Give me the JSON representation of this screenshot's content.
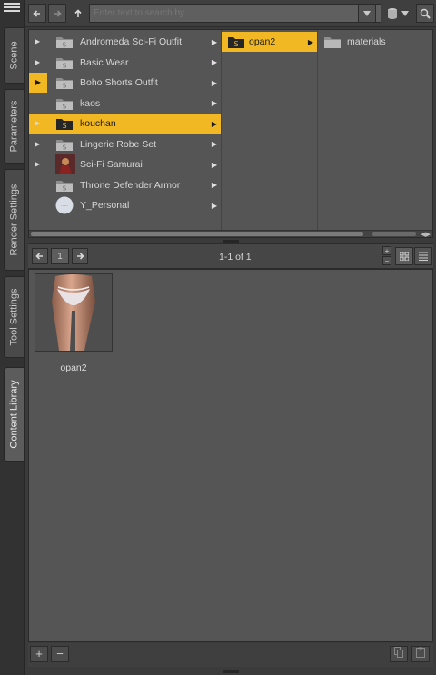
{
  "tabs": [
    {
      "label": "Scene",
      "active": false
    },
    {
      "label": "Parameters",
      "active": false
    },
    {
      "label": "Render Settings",
      "active": false
    },
    {
      "label": "Tool Settings",
      "active": false
    },
    {
      "label": "Content Library",
      "active": true
    }
  ],
  "toolbar": {
    "search_placeholder": "Enter text to search by...",
    "back_icon": "back-arrow-icon",
    "forward_icon": "forward-arrow-icon",
    "up_icon": "up-arrow-icon",
    "filter_icon": "database-icon",
    "search_icon": "magnifier-icon"
  },
  "browser": {
    "column1": [
      {
        "label": "Andromeda Sci-Fi Outfit",
        "expandable": true,
        "icon": "product-folder-icon"
      },
      {
        "label": "Basic Wear",
        "expandable": true,
        "icon": "product-folder-icon"
      },
      {
        "label": "Boho Shorts Outfit",
        "expandable": true,
        "highlight_expander": true,
        "icon": "product-folder-icon"
      },
      {
        "label": "kaos",
        "expandable": false,
        "icon": "product-folder-icon"
      },
      {
        "label": "kouchan",
        "expandable": true,
        "selected": true,
        "icon": "product-folder-icon"
      },
      {
        "label": "Lingerie Robe Set",
        "expandable": true,
        "icon": "product-folder-icon"
      },
      {
        "label": "Sci-Fi Samurai",
        "expandable": true,
        "icon": "product-thumbnail"
      },
      {
        "label": "Throne Defender Armor",
        "expandable": false,
        "icon": "product-folder-icon"
      },
      {
        "label": "Y_Personal",
        "expandable": false,
        "icon": "round-thumbnail"
      }
    ],
    "column2": [
      {
        "label": "opan2",
        "selected": true
      }
    ],
    "column3": [
      {
        "label": "materials"
      }
    ]
  },
  "pagination": {
    "current_page": "1",
    "summary": "1-1 of 1"
  },
  "grid": {
    "items": [
      {
        "label": "opan2",
        "thumbnail": "figure-thighs-thumbnail"
      }
    ]
  },
  "bottom": {
    "add_label": "+",
    "remove_label": "−"
  },
  "colors": {
    "accent": "#f2b824",
    "panel": "#555555",
    "background": "#3b3b3b"
  }
}
